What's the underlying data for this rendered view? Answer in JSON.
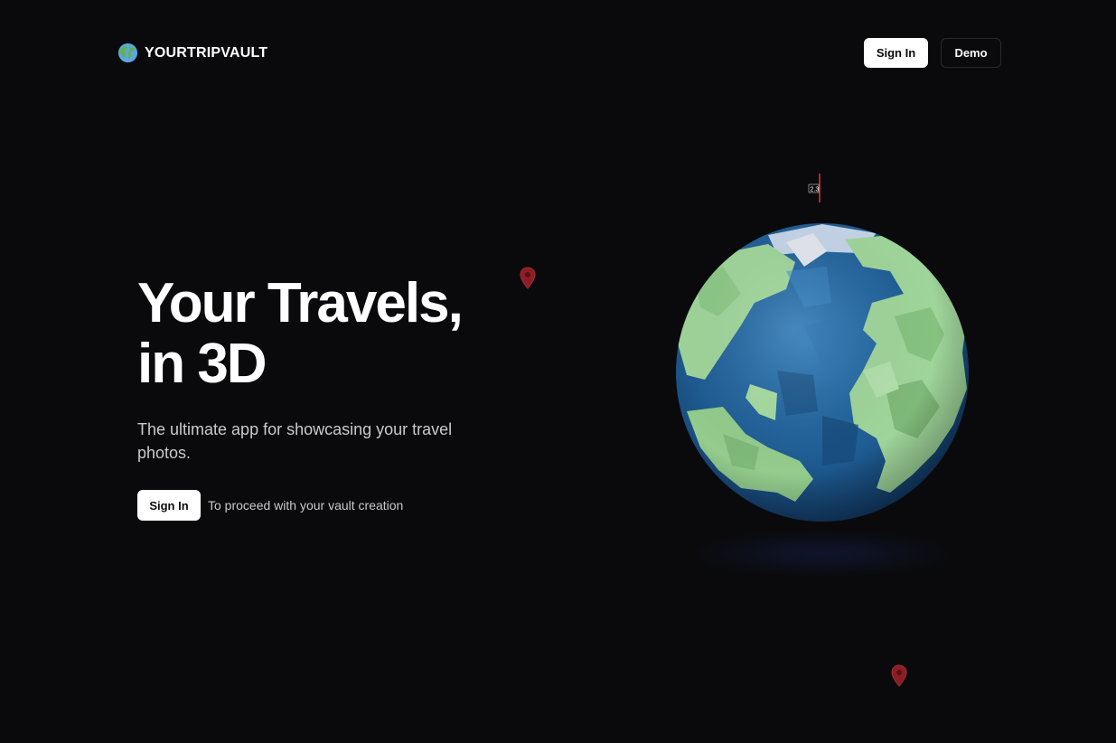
{
  "header": {
    "brand": "YOURTRIPVAULT",
    "brand_icon": "globe-americas-icon",
    "signin_label": "Sign In",
    "demo_label": "Demo"
  },
  "hero": {
    "title_line1": "Your Travels,",
    "title_line2": "in 3D",
    "subtitle": "The ultimate app for showcasing your travel photos.",
    "cta_label": "Sign In",
    "cta_note": "To proceed with your vault creation"
  },
  "scene": {
    "globe_land_color": "#8fcf8a",
    "globe_ocean_color": "#1f5d94",
    "pin_color": "#8b1e25",
    "flag_label": "2.3"
  },
  "colors": {
    "background": "#0a0a0c",
    "primary_button": "#ffffff",
    "text_muted": "#c9c9cf"
  }
}
